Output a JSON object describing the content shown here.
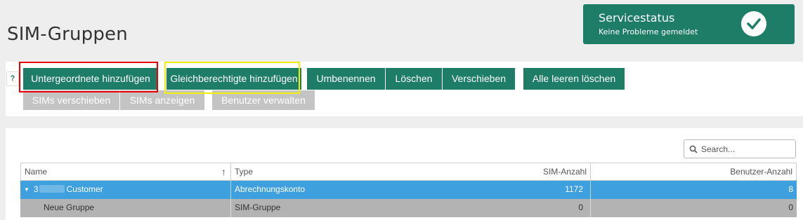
{
  "page": {
    "title": "SIM-Gruppen"
  },
  "service_status": {
    "title": "Servicestatus",
    "subtitle": "Keine Probleme gemeldet",
    "icon": "check-icon",
    "color": "#1e7d67"
  },
  "help": {
    "label": "?"
  },
  "toolbar": {
    "add_child": "Untergeordnete hinzufügen",
    "add_sibling": "Gleichberechtigte hinzufügen",
    "rename": "Umbenennen",
    "delete": "Löschen",
    "move": "Verschieben",
    "delete_all_empty": "Alle leeren löschen",
    "move_sims": "SIMs verschieben",
    "show_sims": "SIMs anzeigen",
    "manage_users": "Benutzer verwalten"
  },
  "search": {
    "placeholder": "Search..."
  },
  "table": {
    "columns": {
      "name": "Name",
      "type": "Type",
      "sims": "SIM-Anzahl",
      "users": "Benutzer-Anzahl"
    },
    "rows": [
      {
        "name_prefix": "3",
        "name_suffix": "Customer",
        "type": "Abrechnungskonto",
        "sims": "1172",
        "users": "8"
      },
      {
        "name": "Neue Gruppe",
        "type": "SIM-Gruppe",
        "sims": "0",
        "users": "0"
      }
    ]
  },
  "colors": {
    "accent": "#1e7d67",
    "selection": "#3fa0df",
    "disabled": "#c4c4c4"
  }
}
